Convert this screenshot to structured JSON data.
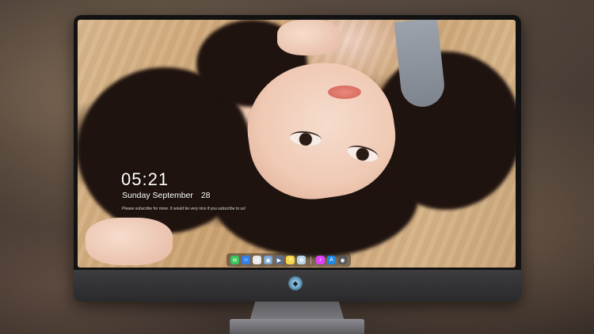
{
  "lockscreen": {
    "time": "05:21",
    "weekday": "Sunday",
    "month": "September",
    "day": "28",
    "caption": "Please subscribe for more. It would be very nice if you subscribe to us!"
  },
  "dock": {
    "apps": [
      {
        "name": "messages-icon",
        "glyph": "✉",
        "color": "#34c759"
      },
      {
        "name": "finder-icon",
        "glyph": "☺",
        "color": "#2f80ed"
      },
      {
        "name": "safari-icon",
        "glyph": "⊙",
        "color": "#e9e9e9"
      },
      {
        "name": "preview-icon",
        "glyph": "▣",
        "color": "#7aa7d6"
      },
      {
        "name": "movie-icon",
        "glyph": "▶",
        "color": "#5b6f8a"
      },
      {
        "name": "notes-icon",
        "glyph": "≡",
        "color": "#f6d64a"
      },
      {
        "name": "photos-icon",
        "glyph": "✿",
        "color": "#b9d3e6"
      }
    ],
    "right_apps": [
      {
        "name": "music-icon",
        "glyph": "♪",
        "color": "#e040fb"
      },
      {
        "name": "appstore-icon",
        "glyph": "A",
        "color": "#1e88e5"
      },
      {
        "name": "camera-icon",
        "glyph": "◉",
        "color": "#55565a"
      }
    ]
  },
  "colors": {
    "bezel": "#121212",
    "chin": "#3d3d40"
  }
}
